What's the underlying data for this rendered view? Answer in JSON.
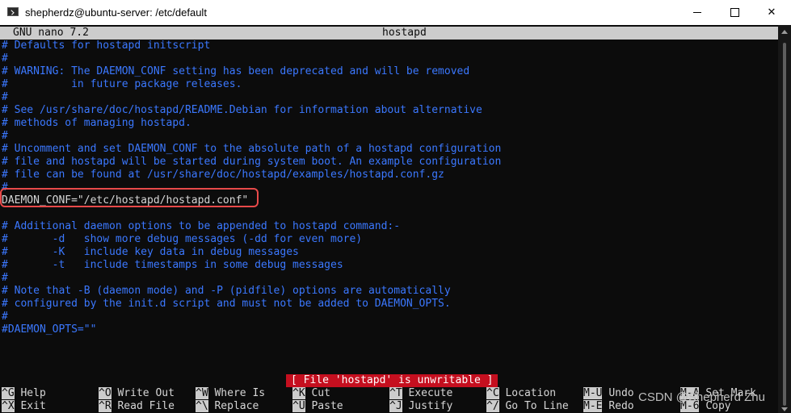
{
  "window": {
    "title": "shepherdz@ubuntu-server: /etc/default",
    "minimize_glyph": "—",
    "close_glyph": "✕"
  },
  "nano": {
    "version": "GNU nano 7.2",
    "filename": "hostapd"
  },
  "file_lines": [
    {
      "text": "# Defaults for hostapd initscript",
      "type": "comment"
    },
    {
      "text": "#",
      "type": "comment"
    },
    {
      "text": "# WARNING: The DAEMON_CONF setting has been deprecated and will be removed",
      "type": "comment"
    },
    {
      "text": "#          in future package releases.",
      "type": "comment"
    },
    {
      "text": "#",
      "type": "comment"
    },
    {
      "text": "# See /usr/share/doc/hostapd/README.Debian for information about alternative",
      "type": "comment"
    },
    {
      "text": "# methods of managing hostapd.",
      "type": "comment"
    },
    {
      "text": "#",
      "type": "comment"
    },
    {
      "text": "# Uncomment and set DAEMON_CONF to the absolute path of a hostapd configuration",
      "type": "comment"
    },
    {
      "text": "# file and hostapd will be started during system boot. An example configuration",
      "type": "comment"
    },
    {
      "text": "# file can be found at /usr/share/doc/hostapd/examples/hostapd.conf.gz",
      "type": "comment"
    },
    {
      "text": "#",
      "type": "comment"
    },
    {
      "text": "DAEMON_CONF=\"/etc/hostapd/hostapd.conf\"",
      "type": "text"
    },
    {
      "text": "",
      "type": "text"
    },
    {
      "text": "# Additional daemon options to be appended to hostapd command:-",
      "type": "comment"
    },
    {
      "text": "#       -d   show more debug messages (-dd for even more)",
      "type": "comment"
    },
    {
      "text": "#       -K   include key data in debug messages",
      "type": "comment"
    },
    {
      "text": "#       -t   include timestamps in some debug messages",
      "type": "comment"
    },
    {
      "text": "#",
      "type": "comment"
    },
    {
      "text": "# Note that -B (daemon mode) and -P (pidfile) options are automatically",
      "type": "comment"
    },
    {
      "text": "# configured by the init.d script and must not be added to DAEMON_OPTS.",
      "type": "comment"
    },
    {
      "text": "#",
      "type": "comment"
    },
    {
      "text": "#DAEMON_OPTS=\"\"",
      "type": "comment"
    }
  ],
  "status_message": "[ File 'hostapd' is unwritable ]",
  "shortcuts": [
    {
      "key": "^G",
      "label": "Help"
    },
    {
      "key": "^X",
      "label": "Exit"
    },
    {
      "key": "^O",
      "label": "Write Out"
    },
    {
      "key": "^R",
      "label": "Read File"
    },
    {
      "key": "^W",
      "label": "Where Is"
    },
    {
      "key": "^\\",
      "label": "Replace"
    },
    {
      "key": "^K",
      "label": "Cut"
    },
    {
      "key": "^U",
      "label": "Paste"
    },
    {
      "key": "^T",
      "label": "Execute"
    },
    {
      "key": "^J",
      "label": "Justify"
    },
    {
      "key": "^C",
      "label": "Location"
    },
    {
      "key": "^/",
      "label": "Go To Line"
    },
    {
      "key": "M-U",
      "label": "Undo"
    },
    {
      "key": "M-E",
      "label": "Redo"
    },
    {
      "key": "M-A",
      "label": "Set Mark"
    },
    {
      "key": "M-6",
      "label": "Copy"
    }
  ],
  "watermark": "CSDN @Shepherd Zhu",
  "colors": {
    "comment": "#3b78ff",
    "text": "#d6d6d6",
    "background": "#0c0c0c",
    "status_bg": "#c50f1f",
    "highlight_border": "#e84a4a"
  }
}
